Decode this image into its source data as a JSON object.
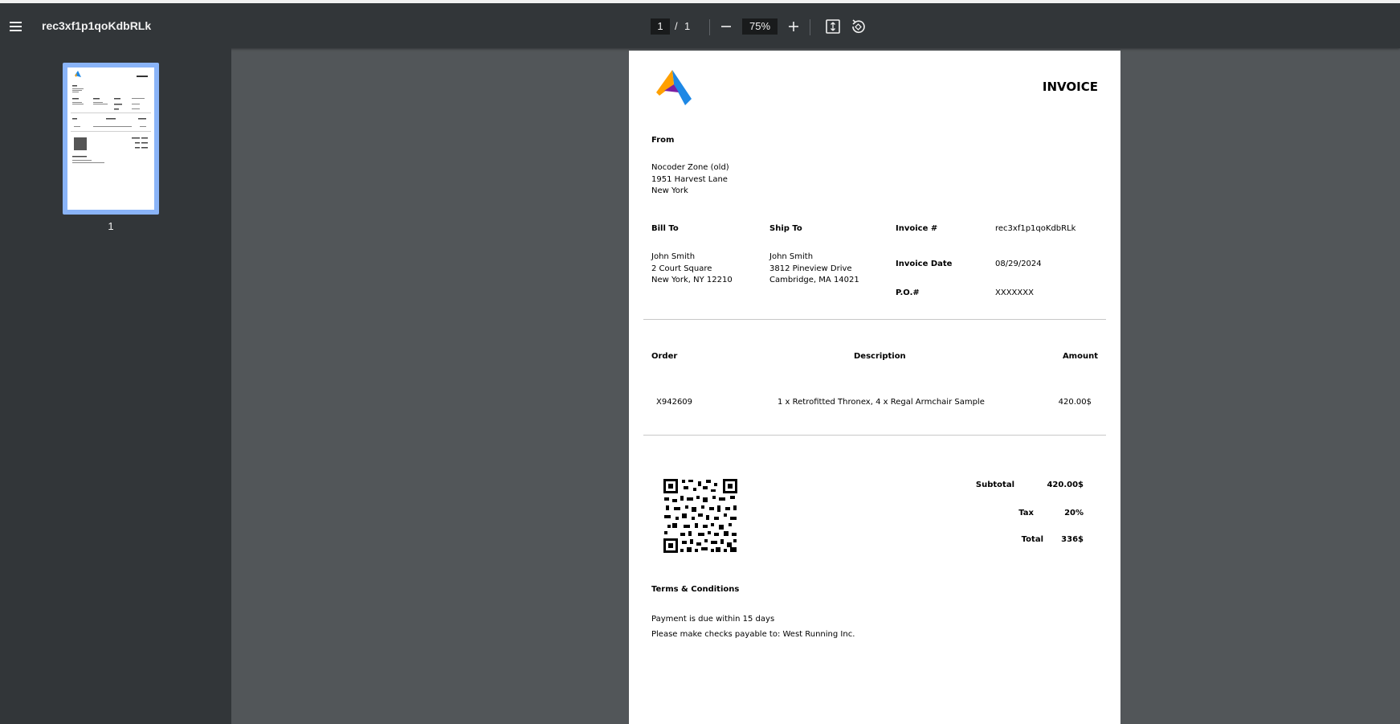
{
  "viewer": {
    "title": "rec3xf1p1qoKdbRLk",
    "current_page": "1",
    "page_separator": "/",
    "total_pages": "1",
    "zoom": "75%",
    "thumbnail_label": "1"
  },
  "icons": {
    "menu": "menu-icon",
    "zoom_out": "minus-icon",
    "zoom_in": "plus-icon",
    "fit": "fit-page-icon",
    "rotate": "rotate-icon"
  },
  "invoice": {
    "heading": "INVOICE",
    "from_label": "From",
    "from_lines": [
      "Nocoder Zone (old)",
      "1951 Harvest Lane",
      "New York"
    ],
    "bill_to_label": "Bill To",
    "bill_to_lines": [
      "John Smith",
      "2 Court Square",
      "New York, NY 12210"
    ],
    "ship_to_label": "Ship To",
    "ship_to_lines": [
      "John Smith",
      "3812 Pineview Drive",
      "Cambridge, MA 14021"
    ],
    "invoice_no_label": "Invoice #",
    "invoice_no": "rec3xf1p1qoKdbRLk",
    "invoice_date_label": "Invoice Date",
    "invoice_date": "08/29/2024",
    "po_label": "P.O.#",
    "po": "XXXXXXX",
    "table": {
      "col_order": "Order",
      "col_description": "Description",
      "col_amount": "Amount",
      "rows": [
        {
          "order": "X942609",
          "description": "1 x Retrofitted Thronex, 4 x Regal Armchair Sample",
          "amount": "420.00$"
        }
      ]
    },
    "subtotal_label": "Subtotal",
    "subtotal": "420.00$",
    "tax_label": "Tax",
    "tax": "20%",
    "total_label": "Total",
    "total": "336$",
    "terms_label": "Terms & Conditions",
    "terms_lines": [
      "Payment is due within 15 days",
      "Please make checks payable to: West Running Inc."
    ]
  },
  "colors": {
    "toolbar_bg": "#323639",
    "viewer_bg": "#525659",
    "thumb_border": "#8ab4f8",
    "logo_blue": "#1e88e5",
    "logo_orange": "#ffa000",
    "logo_purple": "#7b1fa2"
  }
}
